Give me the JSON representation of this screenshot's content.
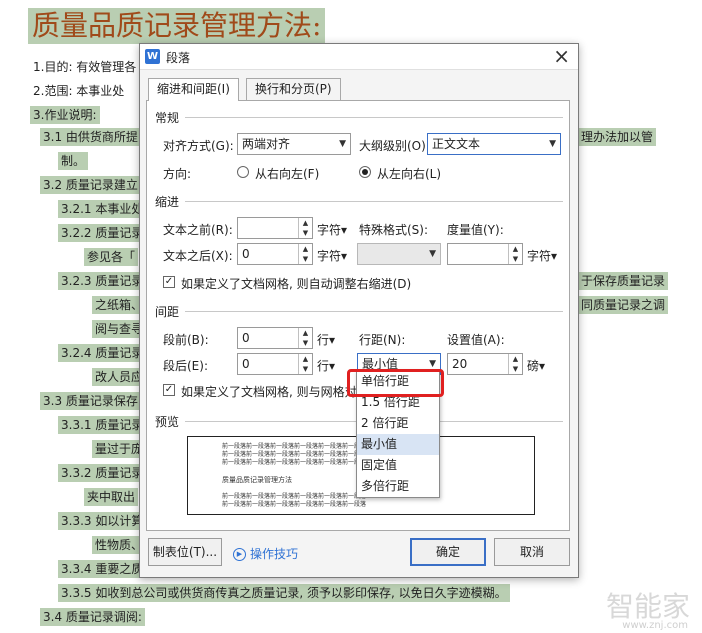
{
  "document": {
    "title": "质量品质记录管理方法:",
    "lines": [
      {
        "text": "1.目的:  有效管理各",
        "hl": false
      },
      {
        "text": "2.范围:  本事业处",
        "hl": false
      },
      {
        "text": "3.作业说明:",
        "hl": true
      },
      {
        "text": "3.1 由供货商所提",
        "hl": true
      },
      {
        "text": "制。",
        "hl": true
      },
      {
        "text": "3.2 质量记录建立",
        "hl": true
      },
      {
        "text": "3.2.1 本事业处",
        "hl": true
      },
      {
        "text": "3.2.2 质量记录",
        "hl": true
      },
      {
        "text": "参见各「",
        "hl": true
      },
      {
        "text": "3.2.3 质量记录",
        "hl": true
      },
      {
        "text": "之纸箱、",
        "hl": true
      },
      {
        "text": "阅与查寻",
        "hl": true
      },
      {
        "text": "3.2.4 质量记录",
        "hl": true
      },
      {
        "text": "改人员应",
        "hl": true
      },
      {
        "text": "3.3 质量记录保存",
        "hl": true
      },
      {
        "text": "3.3.1 质量记录",
        "hl": true
      },
      {
        "text": "量过于庞",
        "hl": true
      },
      {
        "text": "3.3.2 质量记录",
        "hl": true
      },
      {
        "text": "夹中取出",
        "hl": true
      },
      {
        "text": "3.3.3 如以计算",
        "hl": true
      },
      {
        "text": "性物质、",
        "hl": true
      },
      {
        "text": "3.3.4 重要之质",
        "hl": true
      },
      {
        "text": "3.3.5 如收到总公司或供货商传真之质量记录,  须予以影印保存,  以免日久字迹模糊。",
        "hl": true
      },
      {
        "text": "3.4 质量记录调阅:",
        "hl": true
      }
    ],
    "right_fragments": [
      "理办法加以管",
      "于保存质量记录",
      "同质量记录之调"
    ]
  },
  "dialog": {
    "title": "段落",
    "close": "×",
    "app_icon": "W",
    "tabs": [
      "缩进和间距(I)",
      "换行和分页(P)"
    ],
    "general": {
      "section": "常规",
      "align_label": "对齐方式(G):",
      "align_value": "两端对齐",
      "outline_label": "大纲级别(O):",
      "outline_value": "正文文本",
      "direction_label": "方向:",
      "rtl_label": "从右向左(F)",
      "ltr_label": "从左向右(L)"
    },
    "indent": {
      "section": "缩进",
      "before_label": "文本之前(R):",
      "before_value": "",
      "after_label": "文本之后(X):",
      "after_value": "0",
      "unit": "字符▾",
      "special_label": "特殊格式(S):",
      "special_value": "",
      "measure_label": "度量值(Y):",
      "measure_value": "",
      "grid_check": "如果定义了文档网格,  则自动调整右缩进(D)"
    },
    "spacing": {
      "section": "间距",
      "before_label": "段前(B):",
      "before_value": "0",
      "after_label": "段后(E):",
      "after_value": "0",
      "unit": "行▾",
      "line_label": "行距(N):",
      "line_value": "最小值",
      "setval_label": "设置值(A):",
      "setval_value": "20",
      "setval_unit": "磅▾",
      "grid_check": "如果定义了文档网格,  则与网格对齐"
    },
    "line_options": [
      "单倍行距",
      "1.5 倍行距",
      "2 倍行距",
      "最小值",
      "固定值",
      "多倍行距"
    ],
    "selected_option": "最小值",
    "preview": {
      "section": "预览",
      "filler": "前一段落前一段落前一段落前一段落前一段落前一段落",
      "sample": "质量品质记录管理方法"
    },
    "buttons": {
      "tabs_btn": "制表位(T)...",
      "tips": "操作技巧",
      "ok": "确定",
      "cancel": "取消"
    }
  },
  "watermark": {
    "text": "智能家",
    "url": "www.znj.com"
  },
  "colors": {
    "highlight": "#b9ceb2",
    "title": "#a04a1a",
    "accent": "#2f72d4",
    "annotation": "#e02020"
  }
}
